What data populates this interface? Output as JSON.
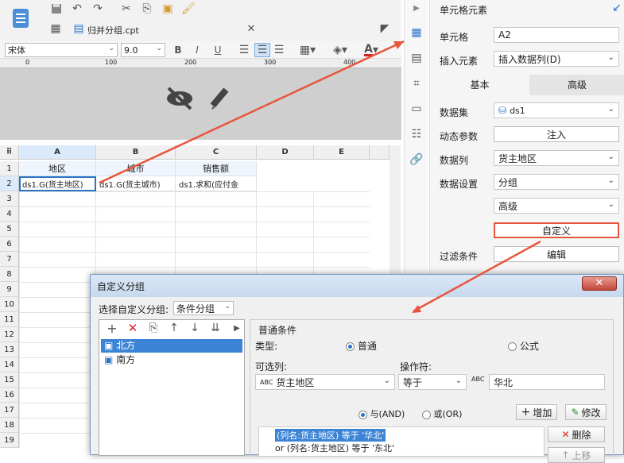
{
  "toolbar": {
    "tab_label": "归并分组.cpt"
  },
  "format": {
    "font": "宋体",
    "size": "9.0",
    "bold": "B",
    "italic": "I",
    "underline": "U",
    "font_color_letter": "A"
  },
  "ruler": {
    "marks": [
      "0",
      "100",
      "200",
      "300",
      "400"
    ]
  },
  "grid": {
    "columns": [
      "A",
      "B",
      "C",
      "D",
      "E"
    ],
    "rows": [
      "1",
      "2",
      "3",
      "4",
      "5",
      "6",
      "7",
      "8",
      "9",
      "10",
      "11",
      "12",
      "13",
      "14",
      "15",
      "16",
      "17",
      "18",
      "19"
    ],
    "row1": [
      "地区",
      "城市",
      "销售额"
    ],
    "row2": [
      "ds1.G(货主地区)",
      "ds1.G(货主城市)",
      "ds1.求和(应付金"
    ]
  },
  "panel": {
    "title": "单元格元素",
    "cell_label": "单元格",
    "cell_value": "A2",
    "insert_label": "插入元素",
    "insert_value": "插入数据列(D)",
    "tab_basic": "基本",
    "tab_advanced": "高级",
    "dataset_label": "数据集",
    "dataset_value": "ds1",
    "dynamic_label": "动态参数",
    "dynamic_button": "注入",
    "column_label": "数据列",
    "column_value": "货主地区",
    "setting_label": "数据设置",
    "setting_value": "分组",
    "advanced_value": "高级",
    "custom_button": "自定义",
    "filter_label": "过滤条件",
    "filter_button": "编辑"
  },
  "dialog": {
    "title": "自定义分组",
    "select_label": "选择自定义分组:",
    "select_value": "条件分组",
    "groups": [
      "北方",
      "南方"
    ],
    "section_title": "普通条件",
    "type_label": "类型:",
    "type_normal": "普通",
    "type_formula": "公式",
    "options_label": "可选列:",
    "operator_label": "操作符:",
    "column_value": "货主地区",
    "operator_value": "等于",
    "value_value": "华北",
    "and_label": "与(AND)",
    "or_label": "或(OR)",
    "add_button": "增加",
    "modify_button": "修改",
    "delete_button": "删除",
    "up_button": "上移",
    "conditions": [
      "(列名:货主地区) 等于 '华北'",
      "or  (列名:货主地区) 等于 '东北'"
    ]
  },
  "colors": {
    "accent": "#2a74c7",
    "arrow": "#e8553d",
    "highlight": "#3c84d6"
  }
}
